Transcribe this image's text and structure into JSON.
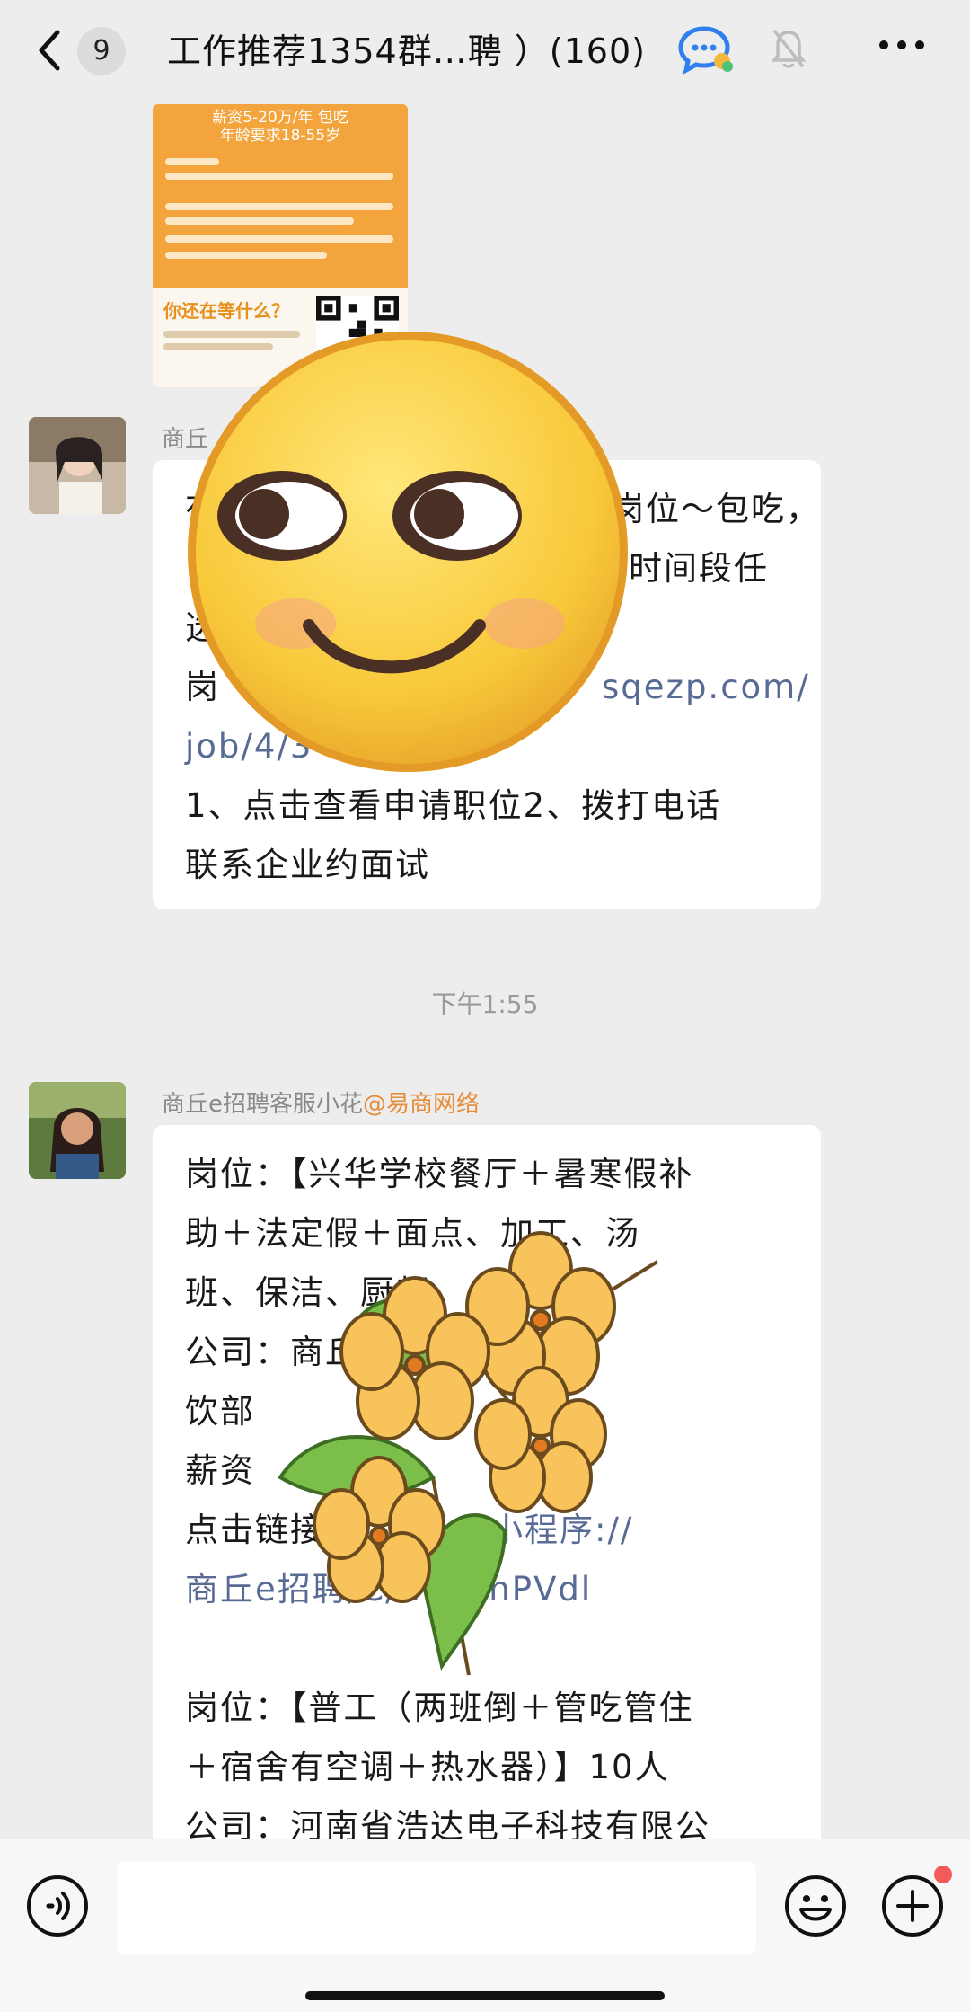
{
  "header": {
    "unread_count": "9",
    "title": "工作推荐1354群…聘 ）(160)"
  },
  "image_message": {
    "text_lines": [
      "薪资5-20万/年 包吃",
      "年龄要求18-55岁"
    ],
    "cta": "你还在等什么？"
  },
  "message1": {
    "sender": "商丘",
    "lines": [
      "岗位～包吃，",
      "时间段任",
      "这",
      "岗位 sqezp.com/",
      "job/4/3",
      "1、点击查看申请职位2、拨打电话",
      "联系企业约面试"
    ],
    "visible_left": [
      "有",
      "",
      "选",
      "岗",
      "",
      "",
      ""
    ],
    "text_a": "1、点击查看申请职位2、拨打电话",
    "text_b": "联系企业约面试"
  },
  "timestamp": "下午1:55",
  "message2": {
    "sender": "商丘e招聘客服小花",
    "mention": "@易商网络",
    "line1": "岗位：【兴华学校餐厅＋暑寒假补",
    "line2": "助＋法定假＋面点、加工、汤",
    "line3": "班、保洁、厨师",
    "line4": "公司：商丘 学校餐",
    "line5": "饮部",
    "line6": "薪资",
    "line7_a": "点击链接",
    "line7_link": "#小程序://",
    "line8_link": "商丘e招聘/C/ RMEnPVdl",
    "line9": "岗位：【普工（两班倒＋管吃管住",
    "line10": "＋宿舍有空调＋热水器）】10人",
    "line11": "公司：河南省浩达电子科技有限公"
  },
  "colors": {
    "background": "#ededed",
    "bubble": "#ffffff",
    "link": "#576b95",
    "mention": "#e58d3a",
    "timestamp": "#9a9a9a"
  },
  "icons": {
    "back": "chevron-left-icon",
    "chat_bubble": "chat-bubble-icon",
    "mute": "bell-off-icon",
    "more": "more-dots-icon",
    "voice": "voice-icon",
    "emoji": "emoji-icon",
    "plus": "plus-icon"
  }
}
